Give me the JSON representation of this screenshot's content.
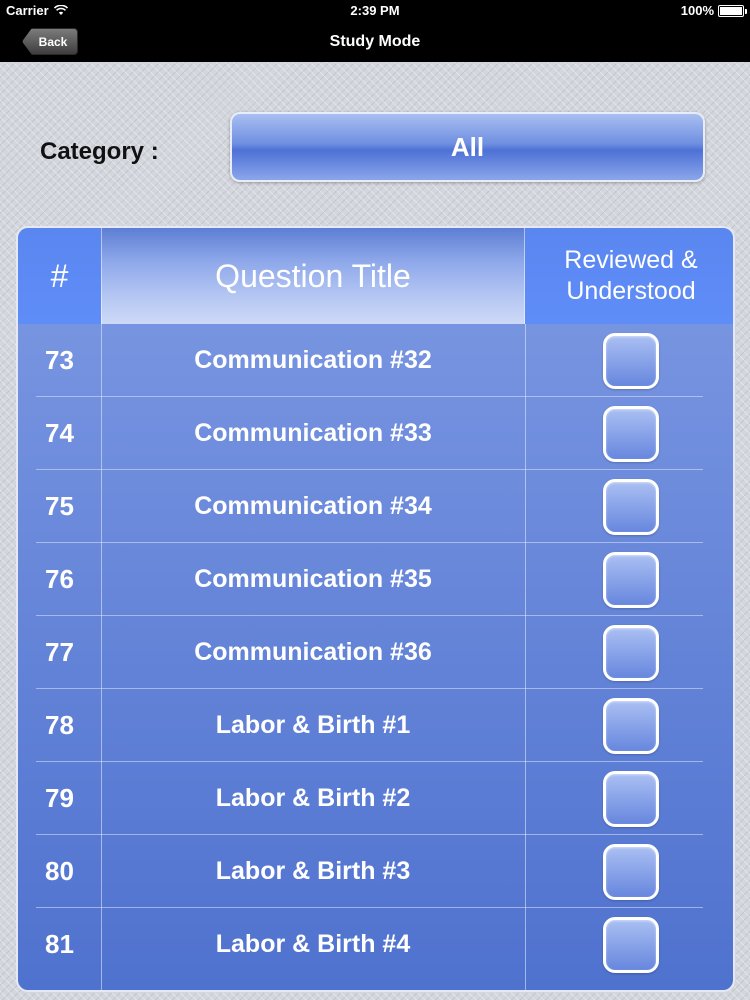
{
  "status_bar": {
    "carrier": "Carrier",
    "time": "2:39 PM",
    "battery": "100%",
    "battery_level": 1.0
  },
  "nav": {
    "back_label": "Back",
    "title": "Study Mode"
  },
  "category": {
    "label": "Category :",
    "value": "All"
  },
  "table": {
    "headers": {
      "num": "#",
      "title": "Question Title",
      "reviewed": "Reviewed & Understood"
    },
    "rows": [
      {
        "num": "73",
        "title": "Communication #32",
        "checked": false
      },
      {
        "num": "74",
        "title": "Communication #33",
        "checked": false
      },
      {
        "num": "75",
        "title": "Communication #34",
        "checked": false
      },
      {
        "num": "76",
        "title": "Communication #35",
        "checked": false
      },
      {
        "num": "77",
        "title": "Communication #36",
        "checked": false
      },
      {
        "num": "78",
        "title": "Labor & Birth #1",
        "checked": false
      },
      {
        "num": "79",
        "title": "Labor & Birth #2",
        "checked": false
      },
      {
        "num": "80",
        "title": "Labor & Birth #3",
        "checked": false
      },
      {
        "num": "81",
        "title": "Labor & Birth #4",
        "checked": false
      }
    ]
  }
}
